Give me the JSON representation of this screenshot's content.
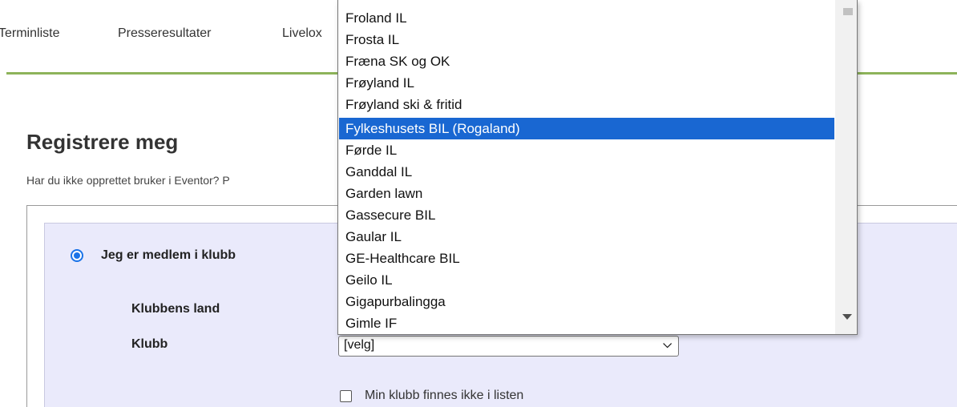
{
  "nav": {
    "items": [
      "Terminliste",
      "Presseresultater",
      "Livelox"
    ]
  },
  "page": {
    "title": "Registrere meg",
    "intro": "Har du ikke opprettet bruker i Eventor? P"
  },
  "form": {
    "member_radio_label": "Jeg er medlem i klubb",
    "country_label": "Klubbens land",
    "club_label": "Klubb",
    "club_select_value": "[velg]",
    "not_listed_label": "Min klubb finnes ikke i listen"
  },
  "dropdown": {
    "options": [
      "Froland IL",
      "Frosta IL",
      "Fræna SK og OK",
      "Frøyland IL",
      "Frøyland ski & fritid",
      "Fylkeshusets BIL (Rogaland)",
      "Førde IL",
      "Ganddal IL",
      "Garden lawn",
      "Gassecure BIL",
      "Gaular IL",
      "GE-Healthcare BIL",
      "Geilo IL",
      "Gigapurbalingga",
      "Gimle IF"
    ],
    "selected_index": 5
  },
  "colors": {
    "accent_line": "#8db35a",
    "selection": "#1967d2",
    "panel_bg": "#eaeafb"
  }
}
